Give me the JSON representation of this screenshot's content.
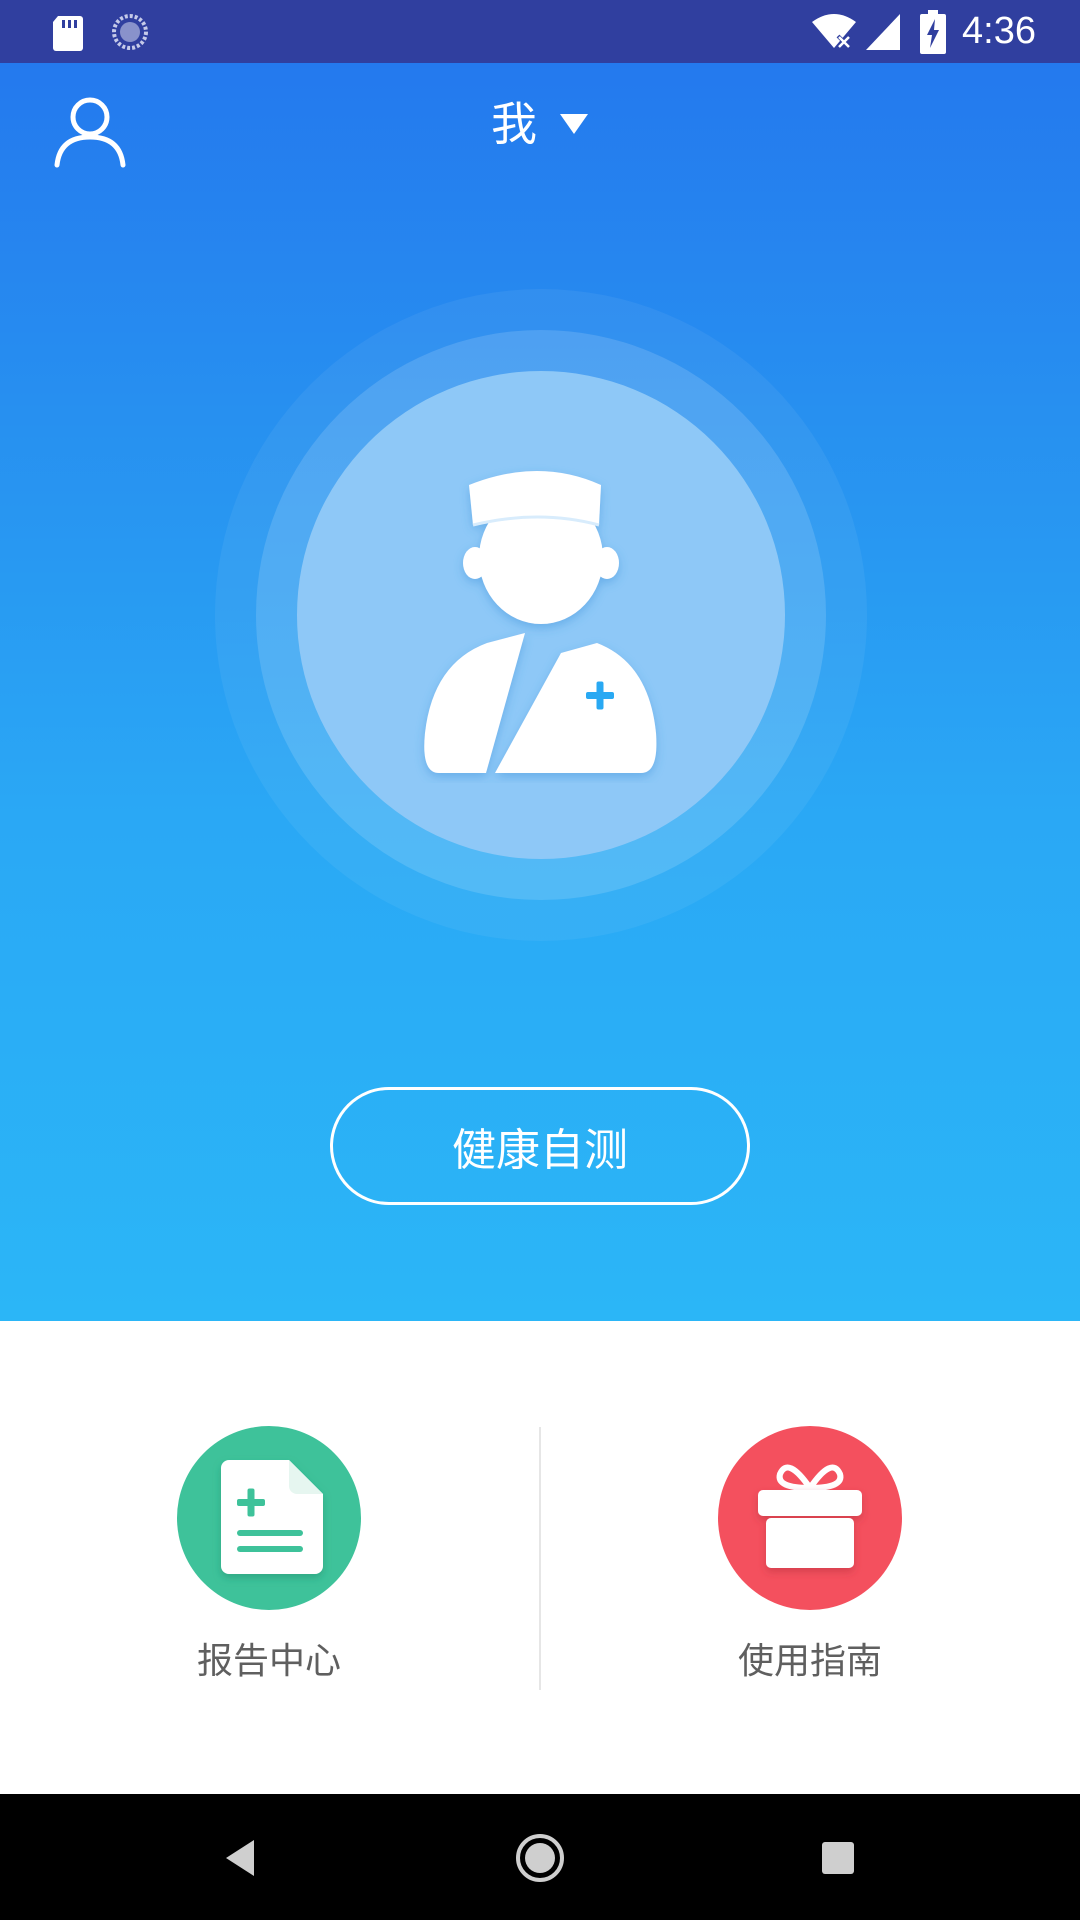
{
  "status_bar": {
    "time": "4:36",
    "icons": [
      "sd-card-icon",
      "sync-icon",
      "wifi-icon",
      "signal-icon",
      "battery-charging-icon"
    ]
  },
  "header": {
    "profile_icon": "user-outline-icon",
    "member_name": "我",
    "dropdown_icon": "triangle-down-icon"
  },
  "hero": {
    "avatar_icon": "doctor-icon",
    "action_button": "健康自测"
  },
  "features": [
    {
      "label": "报告中心",
      "icon": "report-document-icon",
      "color": "#3ec29a"
    },
    {
      "label": "使用指南",
      "icon": "gift-box-icon",
      "color": "#f4505e"
    }
  ],
  "colors": {
    "status_bar": "#303f9f",
    "hero_top": "#2479ee",
    "hero_bottom": "#2bb6f7",
    "nav_bar": "#000000"
  },
  "nav_bar": {
    "buttons": [
      "back-icon",
      "home-icon",
      "recents-icon"
    ]
  }
}
